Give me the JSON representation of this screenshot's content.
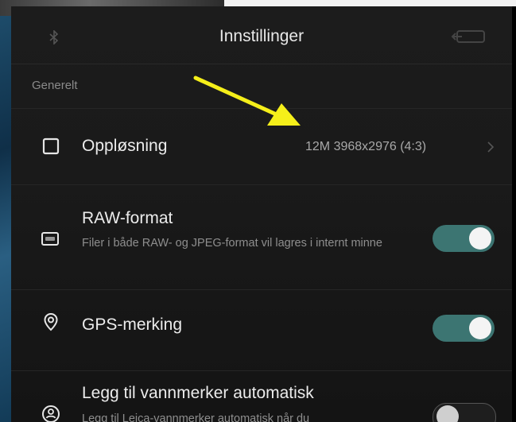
{
  "header": {
    "title": "Innstillinger"
  },
  "section": {
    "label": "Generelt"
  },
  "settings": [
    {
      "id": "resolution",
      "title": "Oppløsning",
      "value": "12M 3968x2976 (4:3)",
      "icon": "aspect-square-icon"
    },
    {
      "id": "raw",
      "title": "RAW-format",
      "subtitle": "Filer i både RAW- og JPEG-format vil lagres i internt minne",
      "enabled": true,
      "icon": "raw-icon"
    },
    {
      "id": "gps",
      "title": "GPS-merking",
      "enabled": true,
      "icon": "location-pin-icon"
    },
    {
      "id": "watermark",
      "title": "Legg til vannmerker automatisk",
      "subtitle": "Legg til Leica-vannmerker automatisk når du",
      "enabled": false,
      "icon": "watermark-icon"
    }
  ],
  "colors": {
    "toggle_on": "#3c7572",
    "annotation": "#f5ef1a",
    "background": "#1a1a1a"
  }
}
